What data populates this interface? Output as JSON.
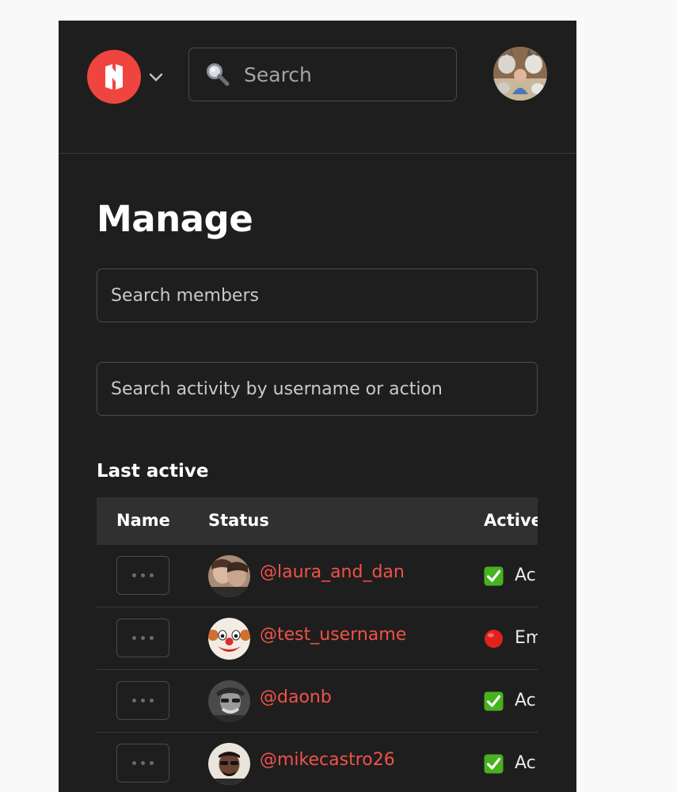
{
  "header": {
    "search_placeholder": "Search",
    "logo_icon": "brand-logo-icon",
    "accent_color": "#f0453e"
  },
  "page": {
    "title": "Manage",
    "members_search_placeholder": "Search members",
    "activity_search_placeholder": "Search activity by username or action",
    "section_label": "Last active"
  },
  "table": {
    "columns": [
      "Name",
      "Status",
      "Active"
    ],
    "rows": [
      {
        "username": "@laura_and_dan",
        "status_icon": "check-icon",
        "status_text": "Ac"
      },
      {
        "username": "@test_username",
        "status_icon": "red-circle-icon",
        "status_text": "Em"
      },
      {
        "username": "@daonb",
        "status_icon": "check-icon",
        "status_text": "Ac"
      },
      {
        "username": "@mikecastro26",
        "status_icon": "check-icon",
        "status_text": "Ac"
      }
    ]
  }
}
